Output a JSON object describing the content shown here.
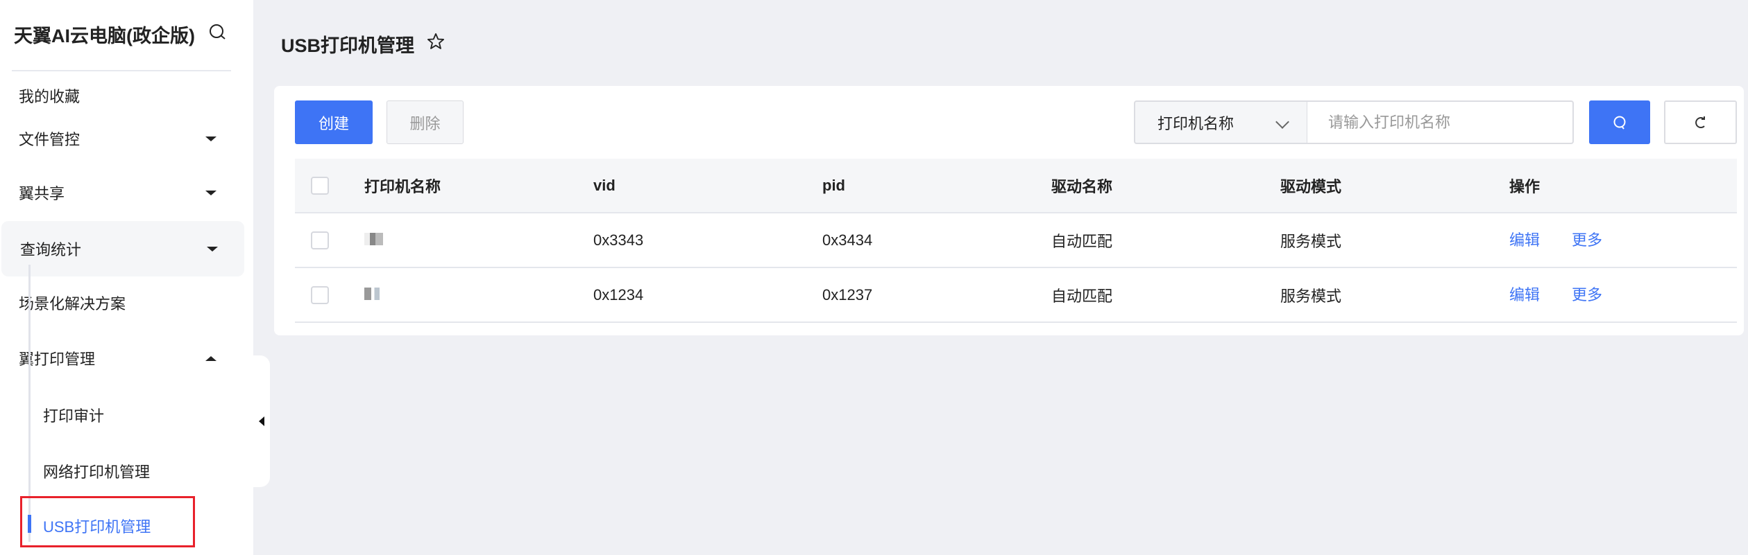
{
  "sidebar": {
    "brand": "天翼AI云电脑(政企版)",
    "items": [
      {
        "label": "我的收藏"
      },
      {
        "label": "文件管控"
      },
      {
        "label": "翼共享"
      },
      {
        "label": "查询统计"
      },
      {
        "label": "场景化解决方案"
      },
      {
        "label": "翼打印管理"
      }
    ],
    "sub_items": [
      {
        "label": "打印审计"
      },
      {
        "label": "网络打印机管理"
      },
      {
        "label": "USB打印机管理"
      }
    ]
  },
  "header": {
    "title": "USB打印机管理"
  },
  "toolbar": {
    "create_label": "创建",
    "delete_label": "删除",
    "filter_select": "打印机名称",
    "search_placeholder": "请输入打印机名称"
  },
  "table": {
    "columns": [
      "打印机名称",
      "vid",
      "pid",
      "驱动名称",
      "驱动模式",
      "操作"
    ],
    "rows": [
      {
        "vid": "0x3343",
        "pid": "0x3434",
        "driver": "自动匹配",
        "mode": "服务模式",
        "edit": "编辑",
        "more": "更多"
      },
      {
        "vid": "0x1234",
        "pid": "0x1237",
        "driver": "自动匹配",
        "mode": "服务模式",
        "edit": "编辑",
        "more": "更多"
      }
    ]
  },
  "colors": {
    "accent": "#3e74f5",
    "highlight_box": "#e8212b"
  }
}
